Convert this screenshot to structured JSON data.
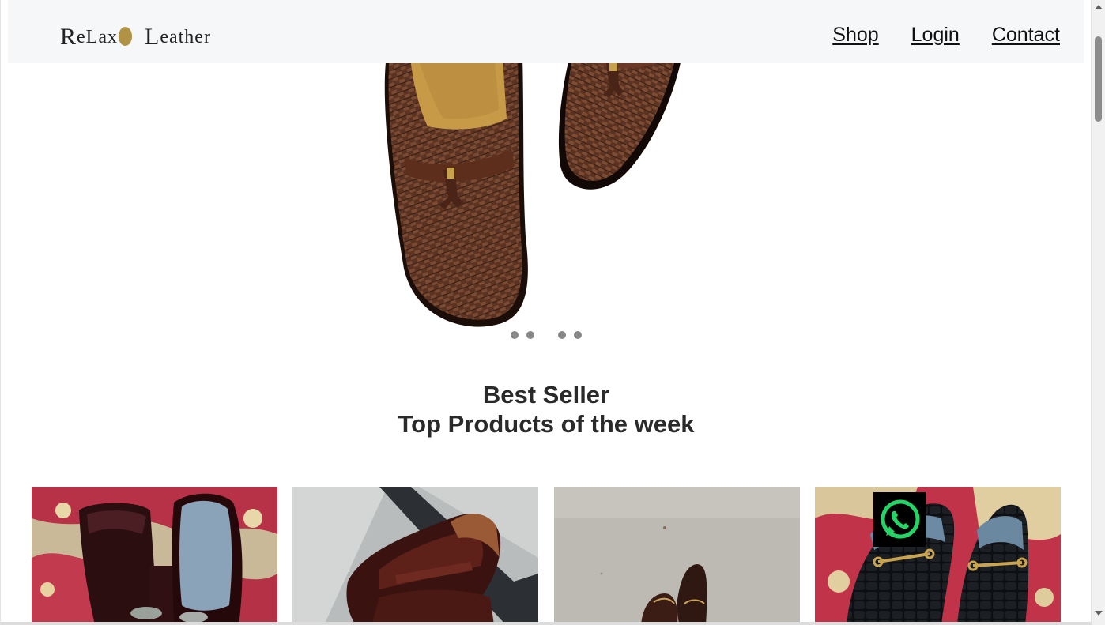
{
  "brand": {
    "logo_part1_big": "R",
    "logo_part1_small": "eLax",
    "logo_part2_big": "L",
    "logo_part2_small": "eather",
    "accent": "#b09345"
  },
  "nav": {
    "items": [
      {
        "label": "Shop"
      },
      {
        "label": "Login"
      },
      {
        "label": "Contact"
      }
    ]
  },
  "hero": {
    "slide_count": 4,
    "active_slide": 1
  },
  "section": {
    "title": "Best Seller",
    "subtitle": "Top Products of the week"
  },
  "products": [
    {
      "icon": "patent-buckle-loafer-photo"
    },
    {
      "icon": "burgundy-penny-loafer-photo"
    },
    {
      "icon": "horsebit-loafer-on-floor-photo"
    },
    {
      "icon": "black-croc-horsebit-loafer-photo"
    }
  ],
  "floating": {
    "icon": "whatsapp-icon",
    "color": "#25d366"
  }
}
